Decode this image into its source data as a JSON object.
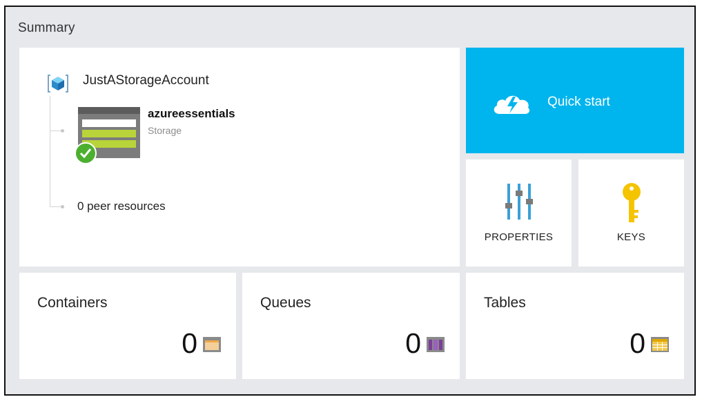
{
  "summary": {
    "title": "Summary"
  },
  "resource_group": {
    "name": "JustAStorageAccount",
    "resource": {
      "name": "azureessentials",
      "type": "Storage"
    },
    "peers": "0 peer resources"
  },
  "quick_start": {
    "label": "Quick start",
    "icon": "cloud-lightning-icon"
  },
  "properties": {
    "label": "PROPERTIES",
    "icon": "sliders-icon"
  },
  "keys": {
    "label": "KEYS",
    "icon": "key-icon"
  },
  "counts": {
    "containers": {
      "label": "Containers",
      "value": "0",
      "icon": "container-icon"
    },
    "queues": {
      "label": "Queues",
      "value": "0",
      "icon": "queue-icon"
    },
    "tables": {
      "label": "Tables",
      "value": "0",
      "icon": "table-icon"
    }
  },
  "colors": {
    "quick_start_bg": "#00b4ed",
    "panel_bg": "#e6e8ec",
    "status_ok": "#4caf2f",
    "storage_green": "#b8d43a",
    "key_yellow": "#f5c400",
    "queue_purple": "#7b3f98",
    "container_orange": "#f0a94a",
    "table_yellow": "#f2c94c"
  }
}
